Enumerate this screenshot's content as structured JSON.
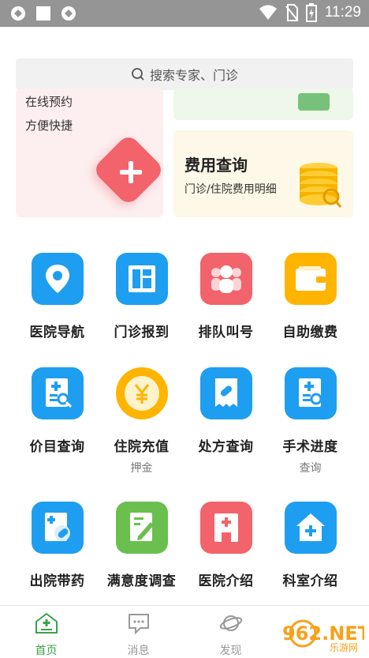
{
  "status_bar": {
    "time": "11:29"
  },
  "search": {
    "placeholder": "搜索专家、门诊"
  },
  "cards": {
    "left": {
      "line1": "在线预约",
      "line2": "方便快捷"
    },
    "fees": {
      "title": "费用查询",
      "subtitle": "门诊/住院费用明细"
    }
  },
  "grid": [
    {
      "label": "医院导航",
      "icon": "map-pin-icon",
      "color": "#1e9ef0"
    },
    {
      "label": "门诊报到",
      "icon": "layout-board-icon",
      "color": "#1e9ef0"
    },
    {
      "label": "排队叫号",
      "icon": "queue-people-icon",
      "color": "#f2636b"
    },
    {
      "label": "自助缴费",
      "icon": "wallet-icon",
      "color": "#ffb400"
    },
    {
      "label": "价目查询",
      "icon": "price-search-icon",
      "color": "#1e9ef0"
    },
    {
      "label": "住院充值",
      "sublabel": "押金",
      "icon": "yen-coin-icon",
      "color": "#ffb400"
    },
    {
      "label": "处方查询",
      "icon": "prescription-icon",
      "color": "#1e9ef0"
    },
    {
      "label": "手术进度",
      "sublabel": "查询",
      "icon": "surgery-doc-icon",
      "color": "#1e9ef0"
    },
    {
      "label": "出院带药",
      "icon": "discharge-medicine-icon",
      "color": "#1e9ef0"
    },
    {
      "label": "满意度调查",
      "icon": "survey-pen-icon",
      "color": "#6bbf4e"
    },
    {
      "label": "医院介绍",
      "icon": "hospital-icon",
      "color": "#f2636b"
    },
    {
      "label": "科室介绍",
      "icon": "department-house-icon",
      "color": "#1e9ef0"
    }
  ],
  "tabs": [
    {
      "label": "首页",
      "icon": "home-plus-icon",
      "active": true
    },
    {
      "label": "消息",
      "icon": "message-icon",
      "active": false
    },
    {
      "label": "发现",
      "icon": "planet-icon",
      "active": false
    }
  ],
  "watermark": {
    "text": "962.NET",
    "subtext": "乐游网"
  }
}
